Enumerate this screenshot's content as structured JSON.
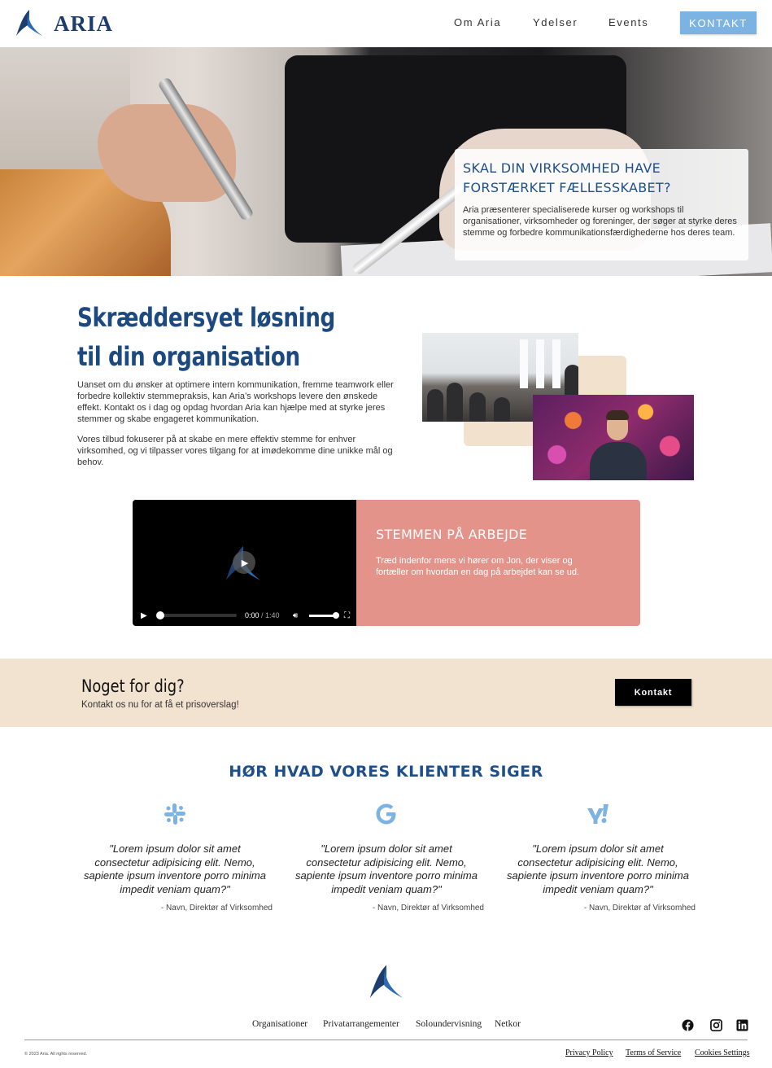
{
  "header": {
    "logo_text": "ARIA",
    "nav": [
      "Om Aria",
      "Ydelser",
      "Events"
    ],
    "cta_label": "KONTAKT"
  },
  "hero": {
    "heading": "SKAL DIN VIRKSOMHED HAVE FORSTÆRKET FÆLLESSKABET?",
    "body": "Aria præsenterer specialiserede kurser og workshops til organisationer, virksomheder og foreninger, der søger at styrke deres stemme og forbedre kommunikationsfærdighederne hos deres team."
  },
  "intro": {
    "title": "Skræddersyet løsning til din organisation",
    "p1": "Uanset om du ønsker at optimere intern kommunikation, fremme teamwork eller forbedre kollektiv stemmepraksis, kan Aria’s workshops levere den ønskede effekt. Kontakt os i dag og opdag hvordan Aria kan hjælpe med at styrke jeres stemmer og skabe engageret kommunikation.",
    "p2": "Vores tilbud fokuserer på at skabe en mere effektiv stemme for enhver virksomhed, og vi tilpasser vores tilgang for at imødekomme dine unikke mål og behov."
  },
  "video": {
    "current_time": "0:00",
    "duration": "/ 1:40",
    "progress": 0,
    "volume": 1.0,
    "title": "STEMMEN PÅ ARBEJDE",
    "text": "Træd indenfor mens vi hører om Jon, der viser og fortæller om hvordan en dag på arbejdet kan se ud."
  },
  "cta": {
    "heading": "Noget for dig?",
    "text": "Kontakt os nu for at få et prisoverslag!",
    "button": "Kontakt"
  },
  "testimonials": {
    "title": "HØR HVAD VORES KLIENTER SIGER",
    "items": [
      {
        "icon": "slack-icon",
        "quote": "\"Lorem ipsum dolor sit amet consectetur adipisicing elit. Nemo, sapiente ipsum inventore porro minima impedit veniam quam?\"",
        "author": "- Navn, Direktør af Virksomhed"
      },
      {
        "icon": "google-icon",
        "quote": "\"Lorem ipsum dolor sit amet consectetur adipisicing elit. Nemo, sapiente ipsum inventore porro minima impedit veniam quam?\"",
        "author": "- Navn, Direktør af Virksomhed"
      },
      {
        "icon": "yahoo-icon",
        "quote": "\"Lorem ipsum dolor sit amet consectetur adipisicing elit. Nemo, sapiente ipsum inventore porro minima impedit veniam quam?\"",
        "author": "- Navn, Direktør af Virksomhed"
      }
    ]
  },
  "footer": {
    "links": [
      "Organisationer",
      "Privatarrangementer",
      "Soloundervisning",
      "Netkor"
    ],
    "social": [
      "facebook-icon",
      "instagram-icon",
      "linkedin-icon"
    ],
    "copyright": "© 2023 Aria. All rights reserved.",
    "legal": [
      "Privacy Policy",
      "Terms of Service",
      "Cookies Settings"
    ]
  },
  "colors": {
    "brand_blue": "#1c3d6e",
    "accent_blue": "#7db3e3",
    "heading_blue": "#1e4f8a",
    "salmon": "#e3938a",
    "sand": "#f2e2d0"
  }
}
